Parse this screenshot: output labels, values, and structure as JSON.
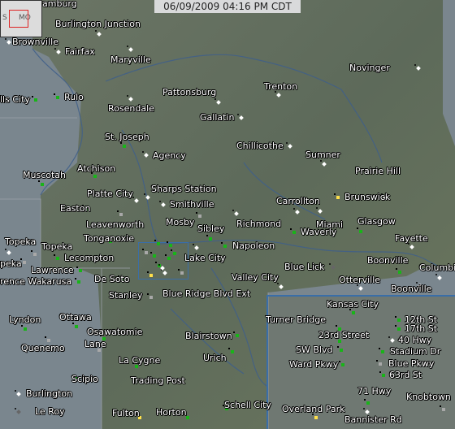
{
  "timestamp": "06/09/2009 04:16 PM CDT",
  "inset": {
    "left_label": "S",
    "right_label": "MO"
  },
  "colors": {
    "green": "#23c623",
    "red": "#e51d1d",
    "orange": "#f49a2a",
    "yellow": "#f3d23b",
    "gray": "#a8a8a8",
    "white": "#f7f7f7"
  },
  "stations": [
    {
      "name": "Burlington Junction",
      "shape": "diamond",
      "color": "green"
    },
    {
      "name": "Brownville",
      "shape": "diamond",
      "color": "green"
    },
    {
      "name": "Fairfax",
      "shape": "diamond",
      "color": "green"
    },
    {
      "name": "Maryville",
      "shape": "diamond",
      "color": "green"
    },
    {
      "name": "Novinger",
      "shape": "diamond",
      "color": "green"
    },
    {
      "name": "Rulo",
      "shape": "square",
      "color": "green"
    },
    {
      "name": "lls City",
      "shape": "square",
      "color": "green"
    },
    {
      "name": "Rosendale",
      "shape": "diamond",
      "color": "red"
    },
    {
      "name": "Pattonsburg",
      "shape": "diamond",
      "color": "orange"
    },
    {
      "name": "Trenton",
      "shape": "diamond",
      "color": "green"
    },
    {
      "name": "Gallatin",
      "shape": "diamond",
      "color": "orange"
    },
    {
      "name": "St. Joseph",
      "shape": "square",
      "color": "green"
    },
    {
      "name": "Chillicothe",
      "shape": "diamond",
      "color": "orange"
    },
    {
      "name": "Agency",
      "shape": "diamond",
      "color": "red"
    },
    {
      "name": "Sumner",
      "shape": "diamond",
      "color": "red"
    },
    {
      "name": "Atchison",
      "shape": "square",
      "color": "green"
    },
    {
      "name": "Prairie Hill",
      "shape": "diamond",
      "color": "green"
    },
    {
      "name": "Muscotah",
      "shape": "square",
      "color": "green"
    },
    {
      "name": "Sharps Station",
      "shape": "diamond",
      "color": "orange"
    },
    {
      "name": "Platte City",
      "shape": "diamond",
      "color": "yellow"
    },
    {
      "name": "Smithville",
      "shape": "diamond",
      "color": "green"
    },
    {
      "name": "Carrollton",
      "shape": "diamond",
      "color": "green"
    },
    {
      "name": "Brunswick",
      "shape": "square",
      "color": "yellow"
    },
    {
      "name": "Easton",
      "shape": "square",
      "color": "green"
    },
    {
      "name": "Leavenworth",
      "shape": "square",
      "color": "gray"
    },
    {
      "name": "Mosby",
      "shape": "square",
      "color": "gray"
    },
    {
      "name": "Sibley",
      "shape": "square",
      "color": "green"
    },
    {
      "name": "Richmond",
      "shape": "diamond",
      "color": "green"
    },
    {
      "name": "Miami",
      "shape": "diamond",
      "color": "green"
    },
    {
      "name": "Waverly",
      "shape": "square",
      "color": "green"
    },
    {
      "name": "Glasgow",
      "shape": "square",
      "color": "green"
    },
    {
      "name": "Fayette",
      "shape": "diamond",
      "color": "green"
    },
    {
      "name": "Topeka",
      "shape": "diamond",
      "color": "green"
    },
    {
      "name": "Topeka",
      "shape": "square",
      "color": "gray"
    },
    {
      "name": "Tonganoxie",
      "shape": "square",
      "color": "green"
    },
    {
      "name": "Napoleon",
      "shape": "square",
      "color": "green"
    },
    {
      "name": "peka",
      "shape": "square",
      "color": "gray"
    },
    {
      "name": "Lecompton",
      "shape": "square",
      "color": "green"
    },
    {
      "name": "Lake City",
      "shape": "diamond",
      "color": "green"
    },
    {
      "name": "Lawrence",
      "shape": "square",
      "color": "green"
    },
    {
      "name": "De Soto",
      "shape": "square",
      "color": "green"
    },
    {
      "name": "Valley City",
      "shape": "diamond",
      "color": "green"
    },
    {
      "name": "Blue Lick",
      "shape": "diamond",
      "color": "white"
    },
    {
      "name": "Boonville",
      "shape": "square",
      "color": "green"
    },
    {
      "name": "Columbi",
      "shape": "diamond",
      "color": "green"
    },
    {
      "name": "rence Wakarusa",
      "shape": "square",
      "color": "green"
    },
    {
      "name": "Stanley",
      "shape": "square",
      "color": "gray"
    },
    {
      "name": "Blue Ridge Blvd Ext",
      "shape": "diamond",
      "color": "green"
    },
    {
      "name": "Otterville",
      "shape": "diamond",
      "color": "green"
    },
    {
      "name": "Boonville",
      "shape": "diamond",
      "color": "green"
    },
    {
      "name": "Kansas City",
      "shape": "square",
      "color": "green"
    },
    {
      "name": "Ottawa",
      "shape": "square",
      "color": "green"
    },
    {
      "name": "Lyndon",
      "shape": "square",
      "color": "green"
    },
    {
      "name": "Turner Bridge",
      "shape": "square",
      "color": "green"
    },
    {
      "name": "12th St",
      "shape": "square",
      "color": "green"
    },
    {
      "name": "17th St",
      "shape": "square",
      "color": "green"
    },
    {
      "name": "Osawatomie",
      "shape": "square",
      "color": "green"
    },
    {
      "name": "23rd Street",
      "shape": "square",
      "color": "green"
    },
    {
      "name": "40 Hwy",
      "shape": "diamond",
      "color": "green"
    },
    {
      "name": "Blairstown",
      "shape": "square",
      "color": "green"
    },
    {
      "name": "Quenemo",
      "shape": "square",
      "color": "gray"
    },
    {
      "name": "Lane",
      "shape": "square",
      "color": "gray"
    },
    {
      "name": "SW Blvd",
      "shape": "square",
      "color": "green"
    },
    {
      "name": "Stadium Dr",
      "shape": "square",
      "color": "green"
    },
    {
      "name": "Urich",
      "shape": "square",
      "color": "green"
    },
    {
      "name": "La Cygne",
      "shape": "square",
      "color": "green"
    },
    {
      "name": "Ward Pkwy",
      "shape": "square",
      "color": "green"
    },
    {
      "name": "Blue Pkwy",
      "shape": "square",
      "color": "gray"
    },
    {
      "name": "63rd St",
      "shape": "square",
      "color": "green"
    },
    {
      "name": "Scipio",
      "shape": "square",
      "color": "green"
    },
    {
      "name": "Trading Post",
      "shape": "square",
      "color": "green"
    },
    {
      "name": "71 Hwy",
      "shape": "square",
      "color": "green"
    },
    {
      "name": "Burlington",
      "shape": "diamond",
      "color": "green"
    },
    {
      "name": "Knobtown",
      "shape": "square",
      "color": "gray"
    },
    {
      "name": "Schell City",
      "shape": "square",
      "color": "green"
    },
    {
      "name": "Overland Park",
      "shape": "square",
      "color": "yellow"
    },
    {
      "name": "Le Roy",
      "shape": "diamond",
      "color": "white"
    },
    {
      "name": "Fulton",
      "shape": "square",
      "color": "yellow"
    },
    {
      "name": "Horton",
      "shape": "square",
      "color": "green"
    },
    {
      "name": "Bannister Rd",
      "shape": "diamond",
      "color": "green"
    }
  ],
  "unlabeled_markers": [
    {
      "shape": "square",
      "color": "gray"
    },
    {
      "shape": "square",
      "color": "green"
    },
    {
      "shape": "square",
      "color": "green"
    },
    {
      "shape": "square",
      "color": "green"
    },
    {
      "shape": "square",
      "color": "green"
    },
    {
      "shape": "square",
      "color": "yellow"
    },
    {
      "shape": "square",
      "color": "green"
    },
    {
      "shape": "square",
      "color": "gray"
    },
    {
      "shape": "diamond",
      "color": "green"
    },
    {
      "shape": "square",
      "color": "green"
    }
  ],
  "header_partial": "amburg"
}
